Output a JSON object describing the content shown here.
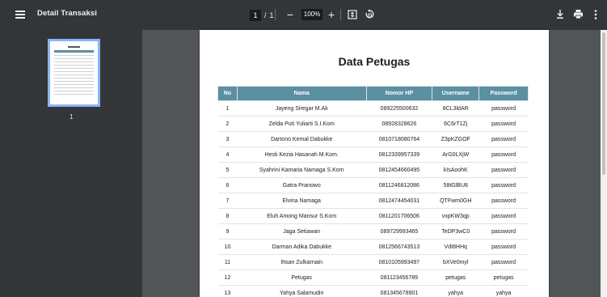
{
  "toolbar": {
    "title": "Detail Transaksi",
    "page_current": "1",
    "page_separator": "/",
    "page_total": "1",
    "zoom": "100%",
    "zoom_out_label": "−",
    "zoom_in_label": "+"
  },
  "sidebar": {
    "thumbnails": [
      {
        "label": "1"
      }
    ]
  },
  "document": {
    "title": "Data Petugas",
    "columns": [
      "No",
      "Nama",
      "Nomor HP",
      "Username",
      "Password"
    ],
    "rows": [
      [
        "1",
        "Jayeng Siregar M.Ak",
        "089225500632",
        "8CL3ldAR",
        "password"
      ],
      [
        "2",
        "Zelda Puti Yuliarti S.I.Kom",
        "08928328626",
        "6C6rT1Zj",
        "password"
      ],
      [
        "3",
        "Dartono Kemal Dabukke",
        "0810718080764",
        "Z3pKZGOF",
        "password"
      ],
      [
        "4",
        "Hesti Kezia Hasanah M.Kom.",
        "0812339957339",
        "ArG0LXjW",
        "password"
      ],
      [
        "5",
        "Syahrini Kamaria Namaga S.Kom",
        "0812454660495",
        "kIsAoohK",
        "password"
      ],
      [
        "6",
        "Gatra Pranowo",
        "0811246812086",
        "58tGlBU8",
        "password"
      ],
      [
        "7",
        "Elvina Namaga",
        "0812474454031",
        "QTFwm0GH",
        "password"
      ],
      [
        "8",
        "Eluh Among Mansur S.Kom",
        "0811201706506",
        "vxpKW3qp",
        "password"
      ],
      [
        "9",
        "Jaga Setiawan",
        "089729993465",
        "TeDP3wC0",
        "password"
      ],
      [
        "10",
        "Darman Adika Dabukke",
        "0812566743513",
        "VdI8HHq",
        "password"
      ],
      [
        "11",
        "Ihsan Zulkarnain",
        "0810105993497",
        "bXVe0myl",
        "password"
      ],
      [
        "12",
        "Petugas",
        "081123456789",
        "petugas",
        "petugas"
      ],
      [
        "13",
        "Yahya Salamudin",
        "081345678901",
        "yahya",
        "yahya"
      ]
    ]
  },
  "icons": {
    "menu": "hamburger-menu-icon",
    "fit": "fit-to-page-icon",
    "rotate": "rotate-icon",
    "download": "download-icon",
    "print": "print-icon",
    "more": "more-vertical-icon"
  }
}
